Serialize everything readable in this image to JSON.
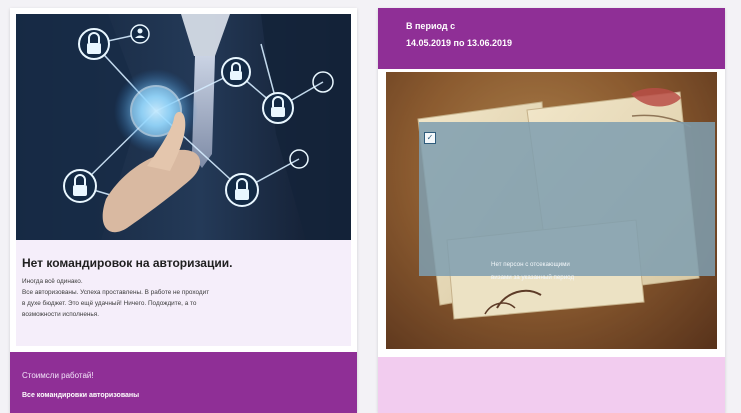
{
  "left_card": {
    "title": "Нет командировок на авторизации.",
    "body_lines": [
      "Иногда всё одинако.",
      "Все авторизованы. Успеха проставлены. В работе не проходит",
      "в духе бюджет. Это ещё удачный! Ничего. Подождите, а то",
      "возможности исполненья."
    ],
    "footer_title": "Стоимсли работай!",
    "footer_subtitle": "Все командировки авторизованы"
  },
  "right_card": {
    "period_line1": "В период с",
    "period_line2": "14.05.2019 по 13.06.2019",
    "message_line1": "Нет персон с отсекающими",
    "message_line2": "визами за указанный период"
  },
  "icons": {
    "lock": "lock-icon",
    "checkbox": "checkbox-icon",
    "person": "person-icon",
    "letters": "letters-illustration"
  },
  "colors": {
    "accent": "#8f2f96",
    "soft_purple": "#f5eefa",
    "pink_panel": "#f2ccef",
    "overlay": "#7f9eb0"
  }
}
